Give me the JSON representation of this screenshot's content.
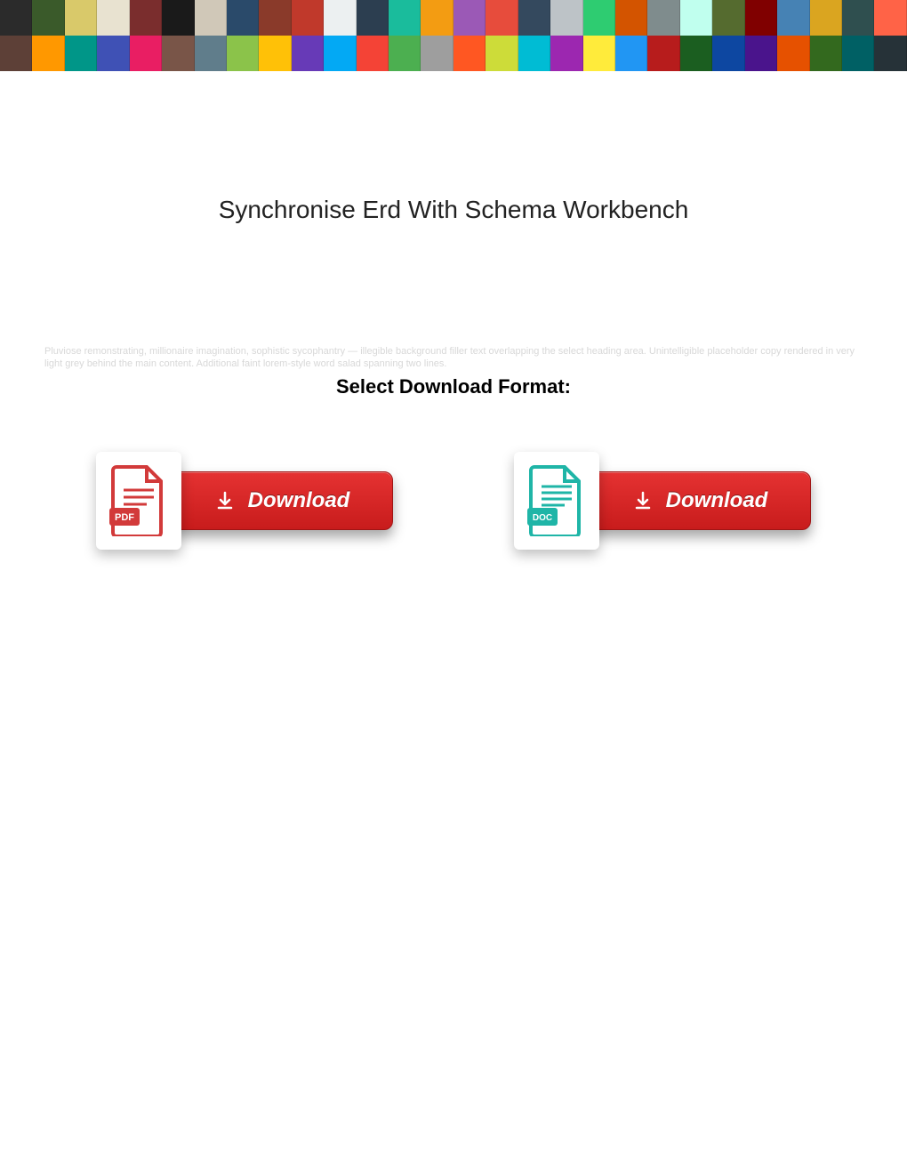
{
  "page": {
    "title": "Synchronise Erd With Schema Workbench",
    "select_heading": "Select Download Format:",
    "faint_background_text": "Pluviose remonstrating, millionaire imagination, sophistic sycophantry — illegible background filler text overlapping the select heading area. Unintelligible placeholder copy rendered in very light grey behind the main content. Additional faint lorem-style word salad spanning two lines."
  },
  "buttons": {
    "pdf": {
      "badge": "PDF",
      "label": "Download"
    },
    "doc": {
      "badge": "DOC",
      "label": "Download"
    }
  },
  "banner": {
    "tile_colors_row1": [
      "#2b2b2b",
      "#3a5a2a",
      "#d9c96a",
      "#e8e2d0",
      "#7a2d2d",
      "#1a1a1a",
      "#d0c8b8",
      "#2a4a6a",
      "#8a3a2a",
      "#c0392b",
      "#ecf0f1",
      "#2c3e50",
      "#1abc9c",
      "#f39c12",
      "#9b59b6",
      "#e74c3c",
      "#34495e",
      "#bdc3c7",
      "#2ecc71",
      "#d35400",
      "#7f8c8d",
      "#c0ffee",
      "#556b2f",
      "#800000",
      "#4682b4",
      "#daa520",
      "#2f4f4f",
      "#ff6347"
    ],
    "tile_colors_row2": [
      "#5d4037",
      "#ff9800",
      "#009688",
      "#3f51b5",
      "#e91e63",
      "#795548",
      "#607d8b",
      "#8bc34a",
      "#ffc107",
      "#673ab7",
      "#03a9f4",
      "#f44336",
      "#4caf50",
      "#9e9e9e",
      "#ff5722",
      "#cddc39",
      "#00bcd4",
      "#9c27b0",
      "#ffeb3b",
      "#2196f3",
      "#b71c1c",
      "#1b5e20",
      "#0d47a1",
      "#4a148c",
      "#e65100",
      "#33691e",
      "#006064",
      "#263238"
    ]
  }
}
